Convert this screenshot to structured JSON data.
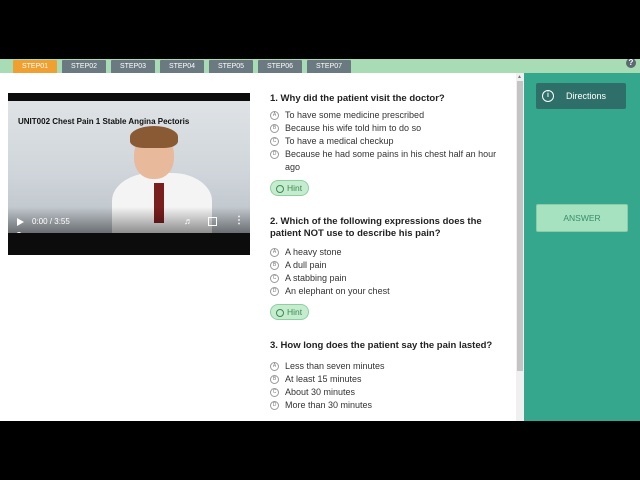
{
  "steps": [
    "STEP01",
    "STEP02",
    "STEP03",
    "STEP04",
    "STEP05",
    "STEP06",
    "STEP07"
  ],
  "help_symbol": "?",
  "video": {
    "title": "UNIT002 Chest Pain 1 Stable Angina Pectoris",
    "time": "0:00 / 3:55",
    "progress": 0
  },
  "questions": [
    {
      "title": "1.  Why did the patient visit the doctor?",
      "options": [
        {
          "letter": "A",
          "text": "To have some medicine prescribed"
        },
        {
          "letter": "B",
          "text": "Because his wife told him to do so"
        },
        {
          "letter": "C",
          "text": "To have a medical checkup"
        },
        {
          "letter": "D",
          "text": "Because he had some pains in his chest half an hour ago"
        }
      ],
      "hint": "Hint"
    },
    {
      "title": "2.  Which of the following expressions does the patient NOT use to describe his pain?",
      "options": [
        {
          "letter": "A",
          "text": "A heavy stone"
        },
        {
          "letter": "B",
          "text": "A dull pain"
        },
        {
          "letter": "C",
          "text": "A stabbing pain"
        },
        {
          "letter": "D",
          "text": "An elephant on your chest"
        }
      ],
      "hint": "Hint"
    },
    {
      "title": "3.  How long does the patient say the pain lasted?",
      "options": [
        {
          "letter": "A",
          "text": "Less than seven minutes"
        },
        {
          "letter": "B",
          "text": "At least 15 minutes"
        },
        {
          "letter": "C",
          "text": "About 30 minutes"
        },
        {
          "letter": "D",
          "text": "More than 30 minutes"
        }
      ]
    }
  ],
  "sidebar": {
    "directions_label": "Directions",
    "info_symbol": "i",
    "answer_label": "ANSWER"
  },
  "colors": {
    "step_active": "#f0a030",
    "step_inactive": "#6b7a80",
    "sidebar_bg": "#35a78c",
    "directions_bg": "#2f6f6a",
    "answer_bg": "#a6e2c0"
  },
  "icons": [
    "help-icon",
    "play-icon",
    "volume-icon",
    "fullscreen-icon",
    "more-options-icon",
    "lightbulb-icon",
    "info-icon"
  ]
}
